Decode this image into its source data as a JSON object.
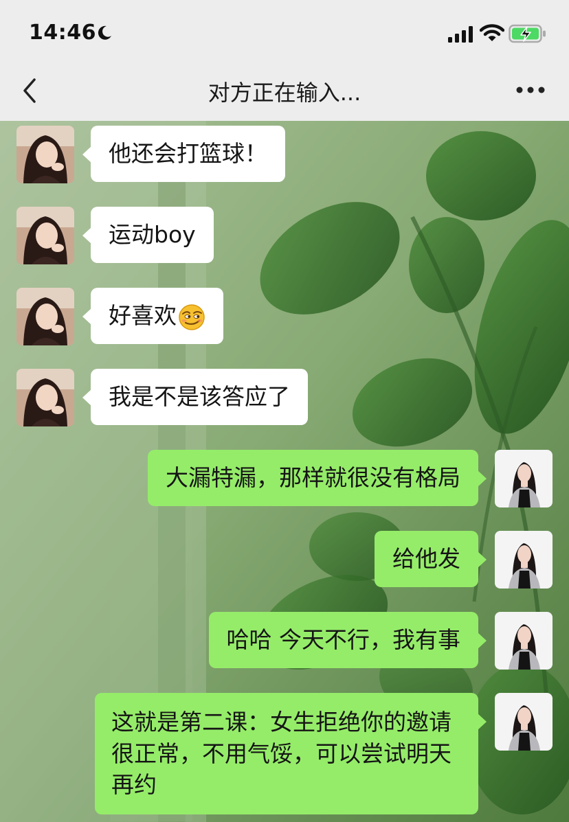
{
  "status_bar": {
    "time": "14:46",
    "moon_icon": "moon-icon",
    "signal_icon": "signal-icon",
    "wifi_icon": "wifi-icon",
    "battery_icon": "battery-charging-icon"
  },
  "nav": {
    "title": "对方正在输入...",
    "back_icon": "chevron-left-icon",
    "more_icon": "more-horizontal-icon"
  },
  "messages": [
    {
      "side": "incoming",
      "text": "他还会打篮球！"
    },
    {
      "side": "incoming",
      "text": "运动boy"
    },
    {
      "side": "incoming",
      "text": "好喜欢",
      "emoji": "smirk-emoji"
    },
    {
      "side": "incoming",
      "text": "我是不是该答应了"
    },
    {
      "side": "outgoing",
      "text": "大漏特漏，那样就很没有格局"
    },
    {
      "side": "outgoing",
      "text": "给他发"
    },
    {
      "side": "outgoing",
      "text": "哈哈 今天不行，我有事"
    },
    {
      "side": "outgoing",
      "text": "这就是第二课：女生拒绝你的邀请很正常，不用气馁，可以尝试明天再约"
    }
  ],
  "colors": {
    "outgoing_bubble": "#95ec69",
    "incoming_bubble": "#ffffff",
    "nav_background": "#ededed"
  }
}
